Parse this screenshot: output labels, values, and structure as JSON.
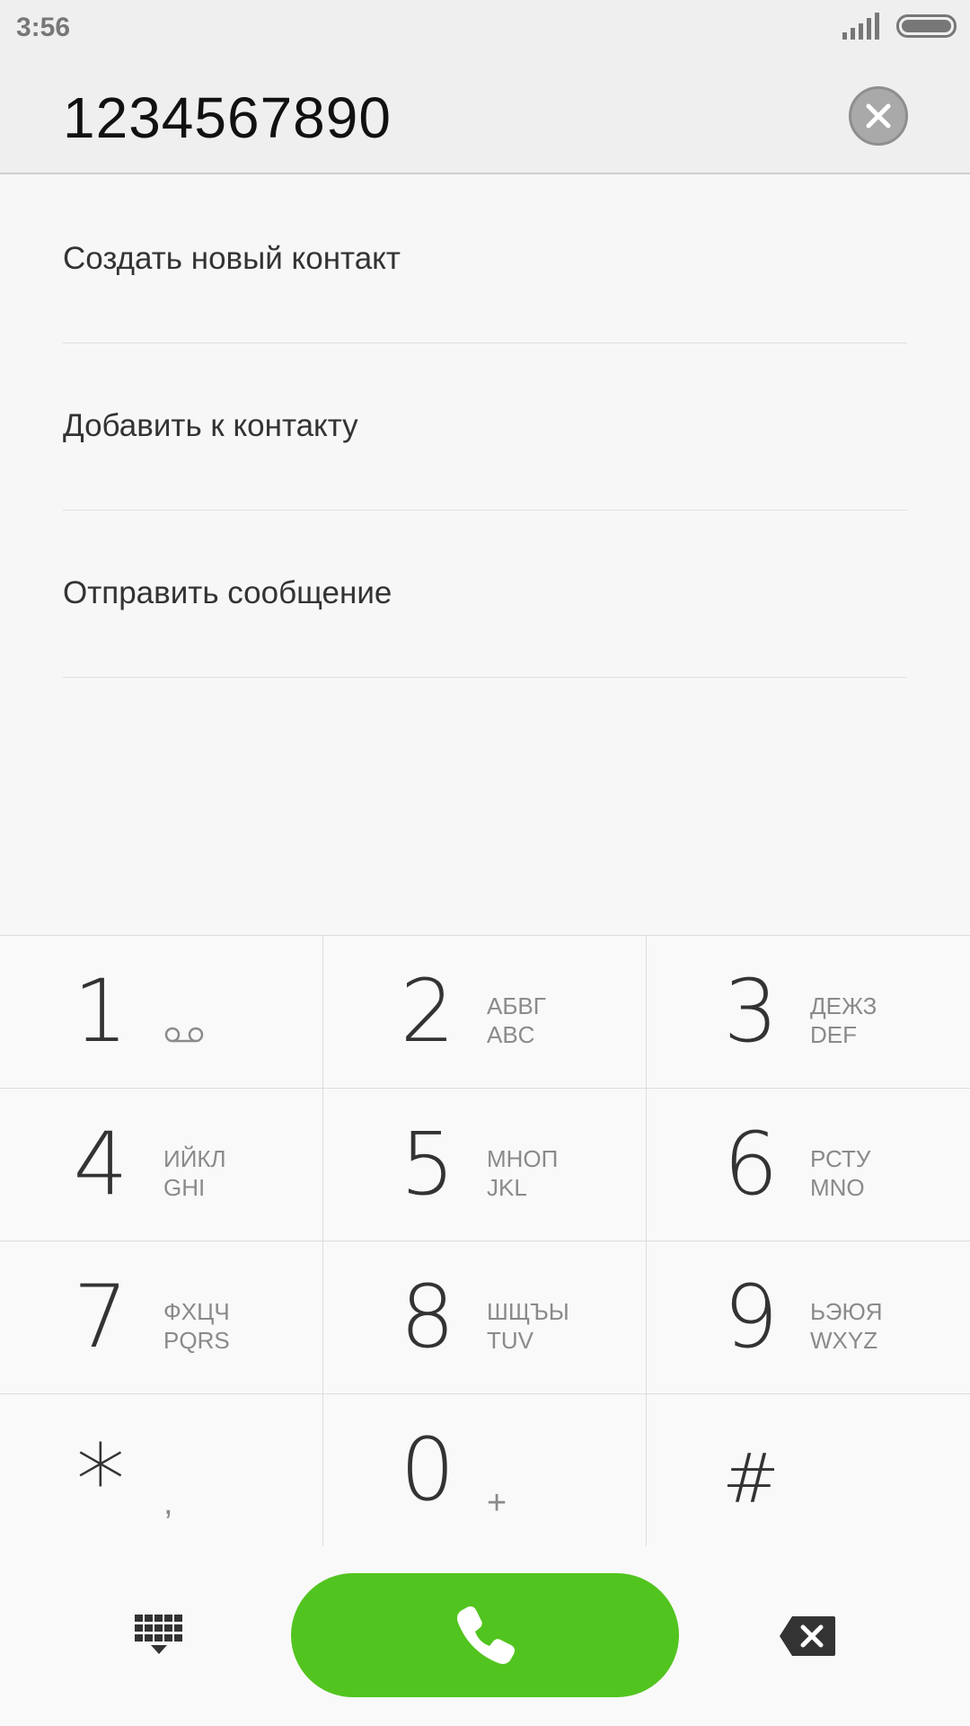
{
  "status_bar": {
    "time": "3:56",
    "signal_icon": "signal-bars-icon",
    "battery_icon": "battery-icon"
  },
  "header": {
    "number": "1234567890",
    "clear_icon": "close-icon"
  },
  "actions": [
    {
      "label": "Создать новый контакт"
    },
    {
      "label": "Добавить к контакту"
    },
    {
      "label": "Отправить сообщение"
    }
  ],
  "keypad": {
    "keys": [
      {
        "digit": "1",
        "line1": "",
        "line2": "",
        "sub": "",
        "icon": "voicemail-icon"
      },
      {
        "digit": "2",
        "line1": "АБВГ",
        "line2": "ABC",
        "sub": ""
      },
      {
        "digit": "3",
        "line1": "ДЕЖЗ",
        "line2": "DEF",
        "sub": ""
      },
      {
        "digit": "4",
        "line1": "ИЙКЛ",
        "line2": "GHI",
        "sub": ""
      },
      {
        "digit": "5",
        "line1": "МНОП",
        "line2": "JKL",
        "sub": ""
      },
      {
        "digit": "6",
        "line1": "РСТУ",
        "line2": "MNO",
        "sub": ""
      },
      {
        "digit": "7",
        "line1": "ФХЦЧ",
        "line2": "PQRS",
        "sub": ""
      },
      {
        "digit": "8",
        "line1": "ШЩЪЫ",
        "line2": "TUV",
        "sub": ""
      },
      {
        "digit": "9",
        "line1": "ЬЭЮЯ",
        "line2": "WXYZ",
        "sub": ""
      },
      {
        "digit": "*",
        "line1": "",
        "line2": "",
        "sub": ","
      },
      {
        "digit": "0",
        "line1": "",
        "line2": "",
        "sub": "+"
      },
      {
        "digit": "#",
        "line1": "",
        "line2": "",
        "sub": ""
      }
    ]
  },
  "bottom_bar": {
    "dialpad_icon": "dialpad-icon",
    "call_icon": "phone-icon",
    "backspace_icon": "backspace-icon",
    "call_color": "#52c41f"
  }
}
